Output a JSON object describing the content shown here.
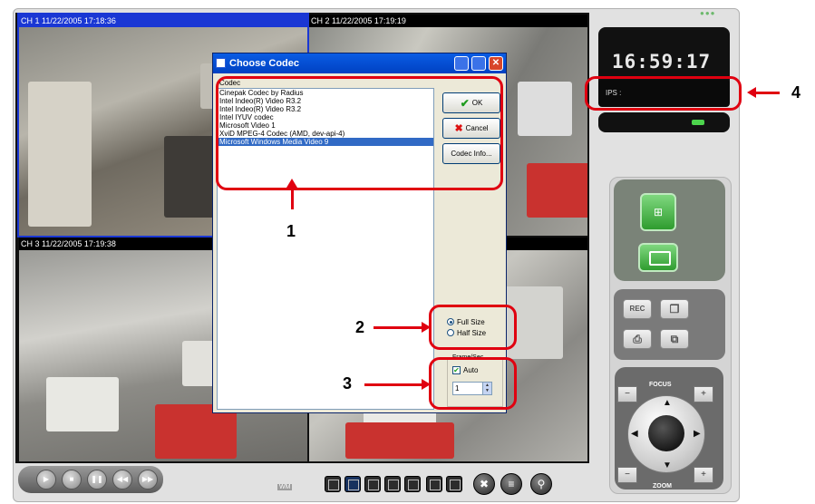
{
  "channels": [
    {
      "caption": "CH 1 11/22/2005 17:18:36"
    },
    {
      "caption": "CH 2 11/22/2005 17:19:19"
    },
    {
      "caption": "CH 3 11/22/2005 17:19:38"
    },
    {
      "caption": ""
    }
  ],
  "dialog": {
    "title": "Choose Codec",
    "codec_label": "Codec",
    "codecs": [
      "Cinepak Codec by Radius",
      "Intel Indeo(R) Video R3.2",
      "Intel Indeo(R) Video R3.2",
      "Intel IYUV codec",
      "Microsoft Video 1",
      "XviD MPEG-4 Codec (AMD, dev-api-4)",
      "Microsoft Windows Media Video 9"
    ],
    "selected_codec": "Microsoft Windows Media Video 9",
    "ok_label": "OK",
    "cancel_label": "Cancel",
    "codec_info_label": "Codec Info...",
    "full_size_label": "Full Size",
    "half_size_label": "Half Size",
    "frame_sec_label": "Frame/Sec",
    "auto_label": "Auto",
    "fps_value": "1"
  },
  "display": {
    "clock": "16:59:17",
    "fps_label": "IPS :"
  },
  "controls": {
    "rec_label": "REC",
    "focus_label": "FOCUS",
    "zoom_label": "ZOOM",
    "plus": "+",
    "minus": "−",
    "wm_label": "WM"
  },
  "annotations": {
    "n1": "1",
    "n2": "2",
    "n3": "3",
    "n4": "4"
  },
  "colors": {
    "highlight": "#e00010",
    "active_caption": "#1a37d4",
    "view_button": "#3faf3f"
  }
}
